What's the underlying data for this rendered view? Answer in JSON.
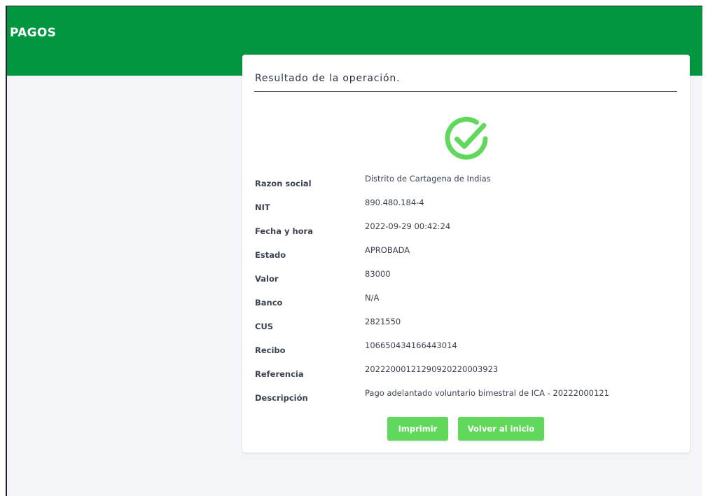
{
  "header": {
    "title": "PAGOS"
  },
  "card": {
    "title": "Resultado de la operación.",
    "status_icon": "check-circle-icon",
    "accent_color": "#5fd85b"
  },
  "details": [
    {
      "label": "Razon social",
      "value": "Distrito de Cartagena de Indias"
    },
    {
      "label": "NIT",
      "value": "890.480.184-4"
    },
    {
      "label": "Fecha y hora",
      "value": "2022-09-29 00:42:24"
    },
    {
      "label": "Estado",
      "value": "APROBADA"
    },
    {
      "label": "Valor",
      "value": "83000"
    },
    {
      "label": "Banco",
      "value": "N/A"
    },
    {
      "label": "CUS",
      "value": "2821550"
    },
    {
      "label": "Recibo",
      "value": "106650434166443014"
    },
    {
      "label": "Referencia",
      "value": "20222000121290920220003923"
    },
    {
      "label": "Descripción",
      "value": "Pago adelantado voluntario bimestral de ICA - 20222000121"
    }
  ],
  "actions": {
    "print_label": "Imprimir",
    "home_label": "Volver al inicio"
  },
  "colors": {
    "header_bg": "#01963f",
    "page_bg": "#f3f5f8",
    "button_bg": "#5fd85b"
  }
}
